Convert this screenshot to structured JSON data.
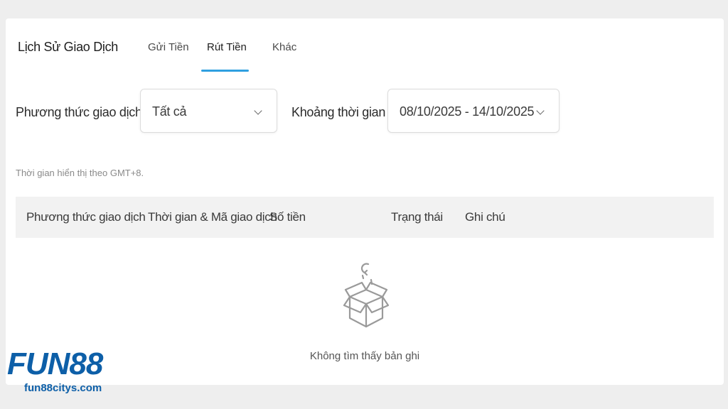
{
  "header": {
    "title": "Lịch Sử Giao Dịch",
    "tabs": [
      {
        "label": "Gửi Tiền",
        "active": false
      },
      {
        "label": "Rút Tiền",
        "active": true
      },
      {
        "label": "Khác",
        "active": false
      }
    ],
    "accent_color": "#2f9fe0"
  },
  "filters": {
    "method_label": "Phương thức giao dịch",
    "method_value": "Tất cả",
    "period_label": "Khoảng thời gian",
    "period_value": "08/10/2025 - 14/10/2025"
  },
  "timezone_note": "Thời gian hiển thị theo GMT+8.",
  "table": {
    "columns": [
      "Phương thức giao dịch",
      "Thời gian & Mã giao dịch",
      "Số tiền",
      "Trạng thái",
      "Ghi chú"
    ],
    "rows": []
  },
  "empty_state": {
    "icon": "empty-box-icon",
    "text": "Không tìm thấy bản ghi"
  },
  "watermark": {
    "logo": "FUN88",
    "site": "fun88citys.com",
    "color": "#0d5fa8"
  }
}
